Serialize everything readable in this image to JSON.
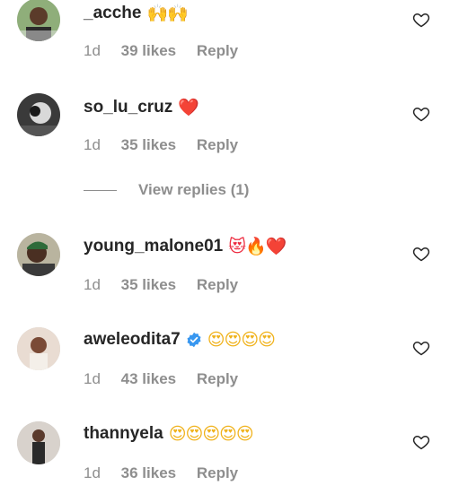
{
  "comments": [
    {
      "username": "_acche",
      "emoji": "🙌🙌",
      "time": "1d",
      "likes": "39 likes",
      "reply": "Reply",
      "verified": false
    },
    {
      "username": "so_lu_cruz",
      "emoji": "❤️",
      "time": "1d",
      "likes": "35 likes",
      "reply": "Reply",
      "verified": false
    },
    {
      "username": "young_malone01",
      "emoji": "😻🔥❤️",
      "time": "1d",
      "likes": "35 likes",
      "reply": "Reply",
      "verified": false
    },
    {
      "username": "aweleodita7",
      "emoji": "😍😍😍😍",
      "time": "1d",
      "likes": "43 likes",
      "reply": "Reply",
      "verified": true
    },
    {
      "username": "thannyela",
      "emoji": "😍😍😍😍😍",
      "time": "1d",
      "likes": "36 likes",
      "reply": "Reply",
      "verified": false
    }
  ],
  "view_replies": "View replies (1)",
  "icons": {
    "like": "heart-outline-icon",
    "verified": "verified-badge-icon"
  },
  "colors": {
    "text": "#262626",
    "muted": "#8e8e8e",
    "verified": "#3897f0"
  }
}
